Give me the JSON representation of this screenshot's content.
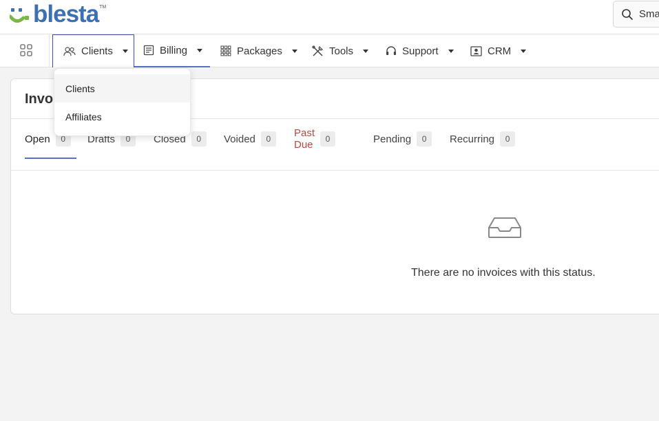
{
  "brand": {
    "name": "blesta",
    "tm": "TM",
    "colors": {
      "blue": "#3d6fb3",
      "green": "#7ab648"
    }
  },
  "search": {
    "text": "Sma"
  },
  "nav": {
    "items": [
      {
        "label": "Clients",
        "icon": "users-icon"
      },
      {
        "label": "Billing",
        "icon": "billing-icon"
      },
      {
        "label": "Packages",
        "icon": "grid-icon"
      },
      {
        "label": "Tools",
        "icon": "tools-icon"
      },
      {
        "label": "Support",
        "icon": "headset-icon"
      },
      {
        "label": "CRM",
        "icon": "id-card-icon"
      }
    ]
  },
  "dropdown": {
    "items": [
      {
        "label": "Clients"
      },
      {
        "label": "Affiliates"
      }
    ]
  },
  "card": {
    "title": "Invoi"
  },
  "tabs": [
    {
      "label": "Open",
      "count": "0"
    },
    {
      "label": "Drafts",
      "count": "0"
    },
    {
      "label": "Closed",
      "count": "0"
    },
    {
      "label": "Voided",
      "count": "0"
    },
    {
      "label": "Past Due",
      "count": "0"
    },
    {
      "label": "Pending",
      "count": "0"
    },
    {
      "label": "Recurring",
      "count": "0"
    }
  ],
  "empty": {
    "message": "There are no invoices with this status.",
    "icon": "inbox-icon"
  },
  "colors": {
    "accent": "#5b6fc6",
    "past_due": "#b84a3b"
  }
}
